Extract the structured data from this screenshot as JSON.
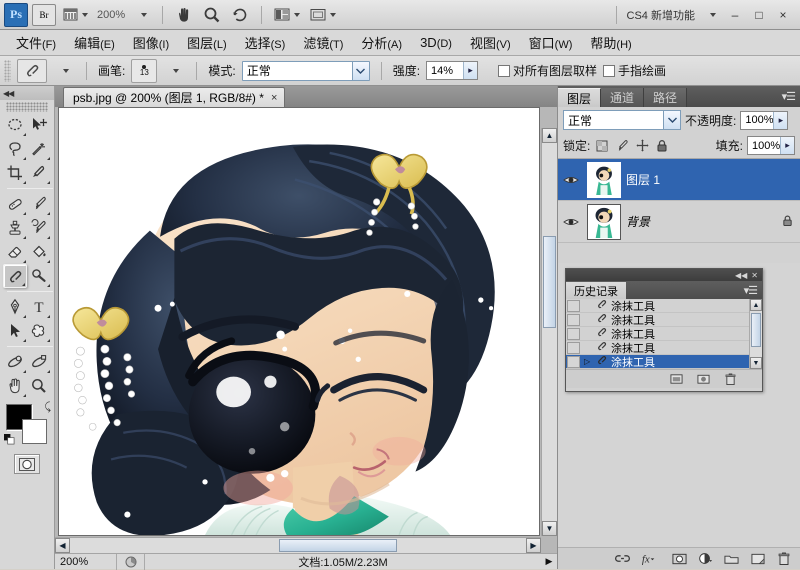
{
  "app": {
    "title": "Adobe Photoshop CS4",
    "logo_text": "Ps",
    "bridge_label": "Br",
    "zoom_level": "200%",
    "workspace_label": "CS4 新增功能",
    "minimize": "–",
    "maximize": "□",
    "close": "×"
  },
  "menubar": {
    "items": [
      {
        "label": "文件",
        "accel": "(F)"
      },
      {
        "label": "编辑",
        "accel": "(E)"
      },
      {
        "label": "图像",
        "accel": "(I)"
      },
      {
        "label": "图层",
        "accel": "(L)"
      },
      {
        "label": "选择",
        "accel": "(S)"
      },
      {
        "label": "滤镜",
        "accel": "(T)"
      },
      {
        "label": "分析",
        "accel": "(A)"
      },
      {
        "label": "3D",
        "accel": "(D)"
      },
      {
        "label": "视图",
        "accel": "(V)"
      },
      {
        "label": "窗口",
        "accel": "(W)"
      },
      {
        "label": "帮助",
        "accel": "(H)"
      }
    ]
  },
  "options_bar": {
    "tool": "smudge-tool",
    "brush_label": "画笔:",
    "brush_size": "13",
    "mode_label": "模式:",
    "mode_value": "正常",
    "strength_label": "强度:",
    "strength_value": "14%",
    "sample_all_layers": "对所有图层取样",
    "finger_painting": "手指绘画"
  },
  "toolbox": {
    "tools": [
      {
        "name": "elliptical-marquee-tool",
        "has_flyout": true
      },
      {
        "name": "move-tool",
        "has_flyout": false
      },
      {
        "name": "lasso-tool",
        "has_flyout": true
      },
      {
        "name": "magic-wand-tool",
        "has_flyout": true
      },
      {
        "name": "crop-tool",
        "has_flyout": true
      },
      {
        "name": "eyedropper-tool",
        "has_flyout": true
      },
      {
        "name": "healing-brush-tool",
        "has_flyout": true
      },
      {
        "name": "brush-tool",
        "has_flyout": true
      },
      {
        "name": "clone-stamp-tool",
        "has_flyout": true
      },
      {
        "name": "history-brush-tool",
        "has_flyout": true
      },
      {
        "name": "eraser-tool",
        "has_flyout": true
      },
      {
        "name": "gradient-tool",
        "has_flyout": true
      },
      {
        "name": "smudge-tool",
        "has_flyout": true,
        "selected": true
      },
      {
        "name": "dodge-tool",
        "has_flyout": true
      },
      {
        "name": "pen-tool",
        "has_flyout": true
      },
      {
        "name": "type-tool",
        "has_flyout": true
      },
      {
        "name": "path-selection-tool",
        "has_flyout": true
      },
      {
        "name": "custom-shape-tool",
        "has_flyout": true
      },
      {
        "name": "3d-rotate-tool",
        "has_flyout": true
      },
      {
        "name": "3d-orbit-tool",
        "has_flyout": true
      },
      {
        "name": "hand-tool",
        "has_flyout": true
      },
      {
        "name": "zoom-tool",
        "has_flyout": false
      }
    ],
    "foreground_color": "#000000",
    "background_color": "#ffffff",
    "quick_mask": "edit-in-quick-mask-mode"
  },
  "document": {
    "tab_title": "psb.jpg @ 200% (图层 1, RGB/8#) *",
    "close_glyph": "×"
  },
  "statusbar": {
    "zoom": "200%",
    "doc_info": "文档:1.05M/2.23M",
    "arrow": "▶"
  },
  "layers_panel": {
    "tabs": [
      "图层",
      "通道",
      "路径"
    ],
    "active_tab": "图层",
    "blend_mode": "正常",
    "opacity_label": "不透明度:",
    "opacity_value": "100%",
    "lock_label": "锁定:",
    "fill_label": "填充:",
    "fill_value": "100%",
    "lock_icons": [
      "lock-transparent-pixels",
      "lock-image-pixels",
      "lock-position",
      "lock-all"
    ],
    "layers": [
      {
        "name": "图层 1",
        "selected": true,
        "visible": true,
        "locked": false
      },
      {
        "name": "背景",
        "selected": false,
        "visible": true,
        "locked": true
      }
    ],
    "footer_buttons": [
      "link-layers-icon",
      "add-layer-style-icon",
      "add-layer-mask-icon",
      "new-adjustment-layer-icon",
      "new-group-icon",
      "new-layer-icon",
      "delete-layer-icon"
    ]
  },
  "history_panel": {
    "title": "历史记录",
    "collapse_glyph": "◀◀",
    "close_glyph": "✕",
    "entries": [
      {
        "label": "涂抹工具",
        "selected": false
      },
      {
        "label": "涂抹工具",
        "selected": false
      },
      {
        "label": "涂抹工具",
        "selected": false
      },
      {
        "label": "涂抹工具",
        "selected": false
      },
      {
        "label": "涂抹工具",
        "selected": true
      }
    ],
    "footer_buttons": [
      "new-document-from-state-icon",
      "new-snapshot-icon",
      "delete-state-icon"
    ]
  },
  "colors": {
    "accent_selection": "#2f64b0",
    "panel_bg": "#d2d2d2",
    "canvas_bg": "#b7b7b7",
    "hair": "#1b2435",
    "skin": "#f3d9bd",
    "collar": "#2fae8e",
    "ribbon": "#e8d46a"
  }
}
